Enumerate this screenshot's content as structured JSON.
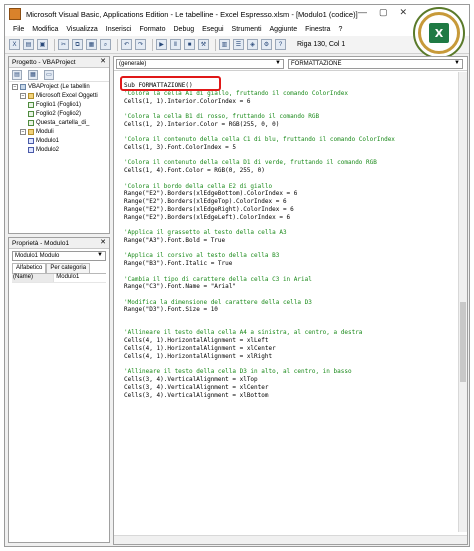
{
  "window": {
    "title": "Microsoft Visual Basic, Applications Edition - Le tabelline - Excel Espresso.xlsm - [Modulo1 (codice)]",
    "controls": [
      "—",
      "▢",
      "✕"
    ]
  },
  "menu": [
    "File",
    "Modifica",
    "Visualizza",
    "Inserisci",
    "Formato",
    "Debug",
    "Esegui",
    "Strumenti",
    "Aggiunte",
    "Finestra",
    "?"
  ],
  "toolbar": {
    "cursor_position": "Riga 130, Col 1"
  },
  "project_panel": {
    "title": "Progetto - VBAProject",
    "tree": [
      {
        "label": "VBAProject (Le tabellin",
        "level": 0,
        "kind": "project",
        "expander": "−"
      },
      {
        "label": "Microsoft Excel Oggetti",
        "level": 1,
        "kind": "folder",
        "expander": "−"
      },
      {
        "label": "Foglio1 (Foglio1)",
        "level": 2,
        "kind": "sheet",
        "expander": ""
      },
      {
        "label": "Foglio2 (Foglio2)",
        "level": 2,
        "kind": "sheet",
        "expander": ""
      },
      {
        "label": "Questa_cartella_di_",
        "level": 2,
        "kind": "sheet",
        "expander": ""
      },
      {
        "label": "Moduli",
        "level": 1,
        "kind": "folder",
        "expander": "−"
      },
      {
        "label": "Modulo1",
        "level": 2,
        "kind": "mod",
        "expander": ""
      },
      {
        "label": "Modulo2",
        "level": 2,
        "kind": "mod",
        "expander": ""
      }
    ]
  },
  "properties_panel": {
    "title": "Proprietà - Modulo1",
    "selected_object": "Modulo1 Modulo",
    "tabs": [
      "Alfabetico",
      "Per categoria"
    ],
    "rows": [
      {
        "key": "(Name)",
        "value": "Modulo1"
      }
    ]
  },
  "code_window": {
    "object_combo": "(generale)",
    "procedure_combo": "FORMATTAZIONE",
    "lines": [
      {
        "text": "Sub FORMATTAZIONE()",
        "type": "code"
      },
      {
        "text": "'Colora la cella A1 di giallo, fruttando il comando ColorIndex",
        "type": "comment"
      },
      {
        "text": "Cells(1, 1).Interior.ColorIndex = 6",
        "type": "code"
      },
      {
        "text": "",
        "type": "blank"
      },
      {
        "text": "'Colora la cella B1 di rosso, fruttando il comando RGB",
        "type": "comment"
      },
      {
        "text": "Cells(1, 2).Interior.Color = RGB(255, 0, 0)",
        "type": "code"
      },
      {
        "text": "",
        "type": "blank"
      },
      {
        "text": "'Colora il contenuto della cella C1 di blu, fruttando il comando ColorIndex",
        "type": "comment"
      },
      {
        "text": "Cells(1, 3).Font.ColorIndex = 5",
        "type": "code"
      },
      {
        "text": "",
        "type": "blank"
      },
      {
        "text": "'Colora il contenuto della cella D1 di verde, fruttando il comando RGB",
        "type": "comment"
      },
      {
        "text": "Cells(1, 4).Font.Color = RGB(0, 255, 0)",
        "type": "code"
      },
      {
        "text": "",
        "type": "blank"
      },
      {
        "text": "'Colora il bordo della cella E2 di giallo",
        "type": "comment"
      },
      {
        "text": "Range(\"E2\").Borders(xlEdgeBottom).ColorIndex = 6",
        "type": "code"
      },
      {
        "text": "Range(\"E2\").Borders(xlEdgeTop).ColorIndex = 6",
        "type": "code"
      },
      {
        "text": "Range(\"E2\").Borders(xlEdgeRight).ColorIndex = 6",
        "type": "code"
      },
      {
        "text": "Range(\"E2\").Borders(xlEdgeLeft).ColorIndex = 6",
        "type": "code"
      },
      {
        "text": "",
        "type": "blank"
      },
      {
        "text": "'Applica il grassetto al testo della cella A3",
        "type": "comment"
      },
      {
        "text": "Range(\"A3\").Font.Bold = True",
        "type": "code"
      },
      {
        "text": "",
        "type": "blank"
      },
      {
        "text": "'Applica il corsivo al testo della cella B3",
        "type": "comment"
      },
      {
        "text": "Range(\"B3\").Font.Italic = True",
        "type": "code"
      },
      {
        "text": "",
        "type": "blank"
      },
      {
        "text": "'Cambia il tipo di carattere della cella C3 in Arial",
        "type": "comment"
      },
      {
        "text": "Range(\"C3\").Font.Name = \"Arial\"",
        "type": "code"
      },
      {
        "text": "",
        "type": "blank"
      },
      {
        "text": "'Modifica la dimensione del carattere della cella D3",
        "type": "comment"
      },
      {
        "text": "Range(\"D3\").Font.Size = 10",
        "type": "code"
      },
      {
        "text": "",
        "type": "blank"
      },
      {
        "text": "",
        "type": "blank"
      },
      {
        "text": "'Allineare il testo della cella A4 a sinistra, al centro, a destra",
        "type": "comment"
      },
      {
        "text": "Cells(4, 1).HorizontalAlignment = xlLeft",
        "type": "code"
      },
      {
        "text": "Cells(4, 1).HorizontalAlignment = xlCenter",
        "type": "code"
      },
      {
        "text": "Cells(4, 1).HorizontalAlignment = xlRight",
        "type": "code"
      },
      {
        "text": "",
        "type": "blank"
      },
      {
        "text": "'Allineare il testo della cella D3 in alto, al centro, in basso",
        "type": "comment"
      },
      {
        "text": "Cells(3, 4).VerticalAlignment = xlTop",
        "type": "code"
      },
      {
        "text": "Cells(3, 4).VerticalAlignment = xlCenter",
        "type": "code"
      },
      {
        "text": "Cells(3, 4).VerticalAlignment = xlBottom",
        "type": "code"
      }
    ]
  },
  "colors": {
    "comment": "#1a8a1a",
    "highlight_box": "#e01818",
    "logo_ring": "#c79a3a",
    "logo_excel": "#1f7a44"
  },
  "icons": {
    "title": "vba-app-icon",
    "logo": "excel-espresso-logo"
  }
}
